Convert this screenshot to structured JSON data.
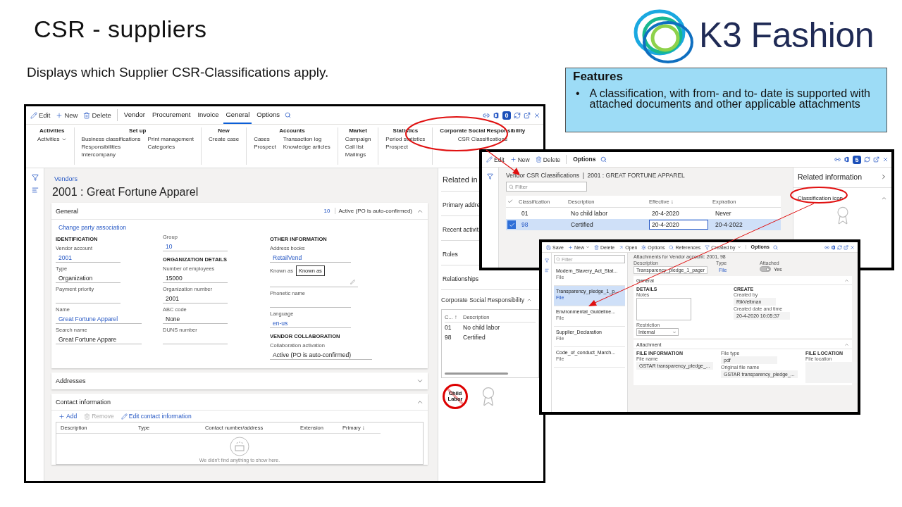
{
  "slide": {
    "title": "CSR - suppliers",
    "subtitle": "Displays which Supplier CSR-Classifications apply.",
    "logo": "K3 Fashion",
    "features": {
      "title": "Features",
      "bullets": [
        {
          "marker": "•",
          "text": "A classification, with from- and to- date is supported with attached documents and other applicable attachments"
        }
      ]
    }
  },
  "vendor_window": {
    "actions": [
      {
        "label": "Edit",
        "kind": "edit"
      },
      {
        "label": "New",
        "kind": "new"
      },
      {
        "label": "Delete",
        "kind": "delete"
      }
    ],
    "tabs": [
      {
        "label": "Vendor",
        "selected": false
      },
      {
        "label": "Procurement",
        "selected": false
      },
      {
        "label": "Invoice",
        "selected": false
      },
      {
        "label": "General",
        "selected": true
      },
      {
        "label": "Options",
        "selected": false
      }
    ],
    "badge": "0",
    "ribbon": [
      {
        "title": "Activities",
        "dropdown": true,
        "columns": [
          [
            "Activities"
          ]
        ]
      },
      {
        "title": "Set up",
        "dropdown": false,
        "columns": [
          [
            "Business classifications",
            "Responsibilities",
            "Intercompany"
          ],
          [
            "Print management",
            "Categories"
          ]
        ]
      },
      {
        "title": "New",
        "dropdown": false,
        "columns": [
          [
            "Create case"
          ]
        ]
      },
      {
        "title": "Accounts",
        "dropdown": false,
        "columns": [
          [
            "Cases",
            "Prospect"
          ],
          [
            "Transaction log",
            "Knowledge articles"
          ]
        ]
      },
      {
        "title": "Market",
        "dropdown": false,
        "columns": [
          [
            "Campaign",
            "Call list",
            "Mailings"
          ]
        ]
      },
      {
        "title": "Statistics",
        "dropdown": false,
        "columns": [
          [
            "Period statistics",
            "Prospect"
          ]
        ]
      },
      {
        "title": "Corporate Social Responsibility",
        "dropdown": false,
        "columns": [
          [
            "CSR Classifications"
          ]
        ]
      }
    ],
    "breadcrumb": "Vendors",
    "title": "2001 : Great Fortune Apparel",
    "general": {
      "title": "General",
      "count": "10",
      "status": "Active (PO is auto-confirmed)",
      "expanded": true,
      "link": "Change party association",
      "columns": [
        [
          {
            "kind": "heading",
            "text": "IDENTIFICATION"
          },
          {
            "kind": "field",
            "label": "Vendor account",
            "value": "2001",
            "link": true
          },
          {
            "kind": "field",
            "label": "Type",
            "value": "Organization",
            "link": false
          },
          {
            "kind": "field",
            "label": "Payment priority"
          },
          {
            "kind": "field",
            "label": "Name",
            "value": "Great Fortune Apparel",
            "link": true
          },
          {
            "kind": "field",
            "label": "Search name",
            "value": "Great Fortune Appare",
            "link": false
          }
        ],
        [
          {
            "kind": "field",
            "label": "Group",
            "value": "10",
            "link": true
          },
          {
            "kind": "heading",
            "text": "ORGANIZATION DETAILS"
          },
          {
            "kind": "field",
            "label": "Number of employees",
            "value": "15000",
            "link": false
          },
          {
            "kind": "field",
            "label": "Organization number",
            "value": "2001",
            "link": false
          },
          {
            "kind": "field",
            "label": "ABC code",
            "value": "None",
            "link": false
          },
          {
            "kind": "field",
            "label": "DUNS number"
          }
        ],
        [
          {
            "kind": "heading",
            "text": "OTHER INFORMATION"
          },
          {
            "kind": "field",
            "label": "Address books",
            "value": "RetailVend",
            "link": true
          },
          {
            "kind": "edit-field",
            "label": "Known as",
            "tooltip": "Known as"
          },
          {
            "kind": "field",
            "label": "Phonetic name"
          },
          {
            "kind": "field",
            "label": "Language",
            "value": "en-us",
            "link": true
          },
          {
            "kind": "heading",
            "text": "VENDOR COLLABORATION"
          },
          {
            "kind": "field",
            "label": "Collaboration activation",
            "value": "Active (PO is auto-confirmed)",
            "link": false
          }
        ]
      ]
    },
    "addresses": {
      "title": "Addresses",
      "expanded": false
    },
    "contact": {
      "title": "Contact information",
      "expanded": true,
      "toolbar": [
        {
          "label": "Add",
          "kind": "new",
          "disabled": false
        },
        {
          "label": "Remove",
          "kind": "delete",
          "disabled": true
        },
        {
          "label": "Edit contact information",
          "kind": "edit",
          "disabled": false
        }
      ],
      "columns": [
        {
          "label": "Description"
        },
        {
          "label": "Type"
        },
        {
          "label": "Contact number/address"
        },
        {
          "label": "Extension"
        },
        {
          "label": "Primary",
          "sort_mark": "↓"
        }
      ],
      "empty": "We didn't find anything to show here."
    },
    "related": {
      "title": "Related in",
      "items": [
        "Primary addre",
        "Recent activit",
        "Roles",
        "Relationships"
      ],
      "csr": {
        "title": "Corporate Social Responsibility",
        "expanded": true,
        "columns": [
          {
            "label": "C...",
            "sort_mark": "↑"
          },
          {
            "label": "Description"
          }
        ],
        "rows": [
          [
            "01",
            "No child labor"
          ],
          [
            "98",
            "Certified"
          ]
        ],
        "icon_text": "Child Labor"
      }
    }
  },
  "csr_window": {
    "actions": [
      {
        "label": "Edit",
        "kind": "edit"
      },
      {
        "label": "New",
        "kind": "new"
      },
      {
        "label": "Delete",
        "kind": "delete"
      }
    ],
    "tab": "Options",
    "badge": "5",
    "title": "Vendor CSR Classifications  |  2001 : GREAT FORTUNE APPAREL",
    "filter_placeholder": "Filter",
    "columns": [
      {
        "label": "Classification"
      },
      {
        "label": "Description"
      },
      {
        "label": "Effective",
        "sort_mark": "↓"
      },
      {
        "label": "Expiration"
      }
    ],
    "rows": [
      {
        "cells": [
          "01",
          "No child labor",
          "20-4-2020",
          "Never"
        ],
        "selected": false
      },
      {
        "cells": [
          "98",
          "Certified",
          "20-4-2020",
          "20-4-2022"
        ],
        "selected": true
      }
    ],
    "related": {
      "title": "Related information",
      "section": "Classification icon",
      "expanded": true
    }
  },
  "attachments_window": {
    "actions": [
      {
        "label": "Save",
        "kind": "save",
        "dropdown": false
      },
      {
        "label": "New",
        "kind": "new",
        "dropdown": true
      },
      {
        "label": "Delete",
        "kind": "delete",
        "dropdown": false
      },
      {
        "label": "Open",
        "kind": "open",
        "dropdown": false
      },
      {
        "label": "Options",
        "kind": "options",
        "dropdown": false
      },
      {
        "label": "References",
        "kind": "search",
        "dropdown": false
      },
      {
        "label": "Created by",
        "kind": "filter",
        "dropdown": true
      }
    ],
    "tab": "Options",
    "filter_placeholder": "Filter",
    "items": [
      {
        "name": "Modern_Slavery_Act_Stat...",
        "type": "File",
        "selected": false
      },
      {
        "name": "Transparency_pledge_1_p...",
        "type": "File",
        "selected": true
      },
      {
        "name": "Environmental_Guideline...",
        "type": "File",
        "selected": false
      },
      {
        "name": "Supplier_Declaration",
        "type": "File",
        "selected": false
      },
      {
        "name": "Code_of_conduct_March...",
        "type": "File",
        "selected": false
      }
    ],
    "heading": "Attachments for Vendor account: 2001, 98",
    "description": {
      "label": "Description",
      "value": "Transparency_pledge_1_pager"
    },
    "type": {
      "label": "Type",
      "value": "File"
    },
    "attached": {
      "label": "Attached",
      "on": true,
      "text": "Yes"
    },
    "general": {
      "title": "General",
      "expanded": true,
      "details_heading": "DETAILS",
      "notes_label": "Notes",
      "restriction_label": "Restriction",
      "restriction": "Internal",
      "create_heading": "CREATE",
      "created_by_label": "Created by",
      "created_by": "RikVeltman",
      "created_label": "Created date and time",
      "created": "20-4-2020 10:05:37"
    },
    "attachment": {
      "title": "Attachment",
      "expanded": true,
      "info_heading": "FILE INFORMATION",
      "file_name_label": "File name",
      "file_name": "GSTAR transparency_pledge_...",
      "file_type_label": "File type",
      "file_type": "pdf",
      "original_label": "Original file name",
      "original": "GSTAR transparency_pledge_...",
      "location_heading": "FILE LOCATION",
      "location_label": "File location"
    }
  }
}
